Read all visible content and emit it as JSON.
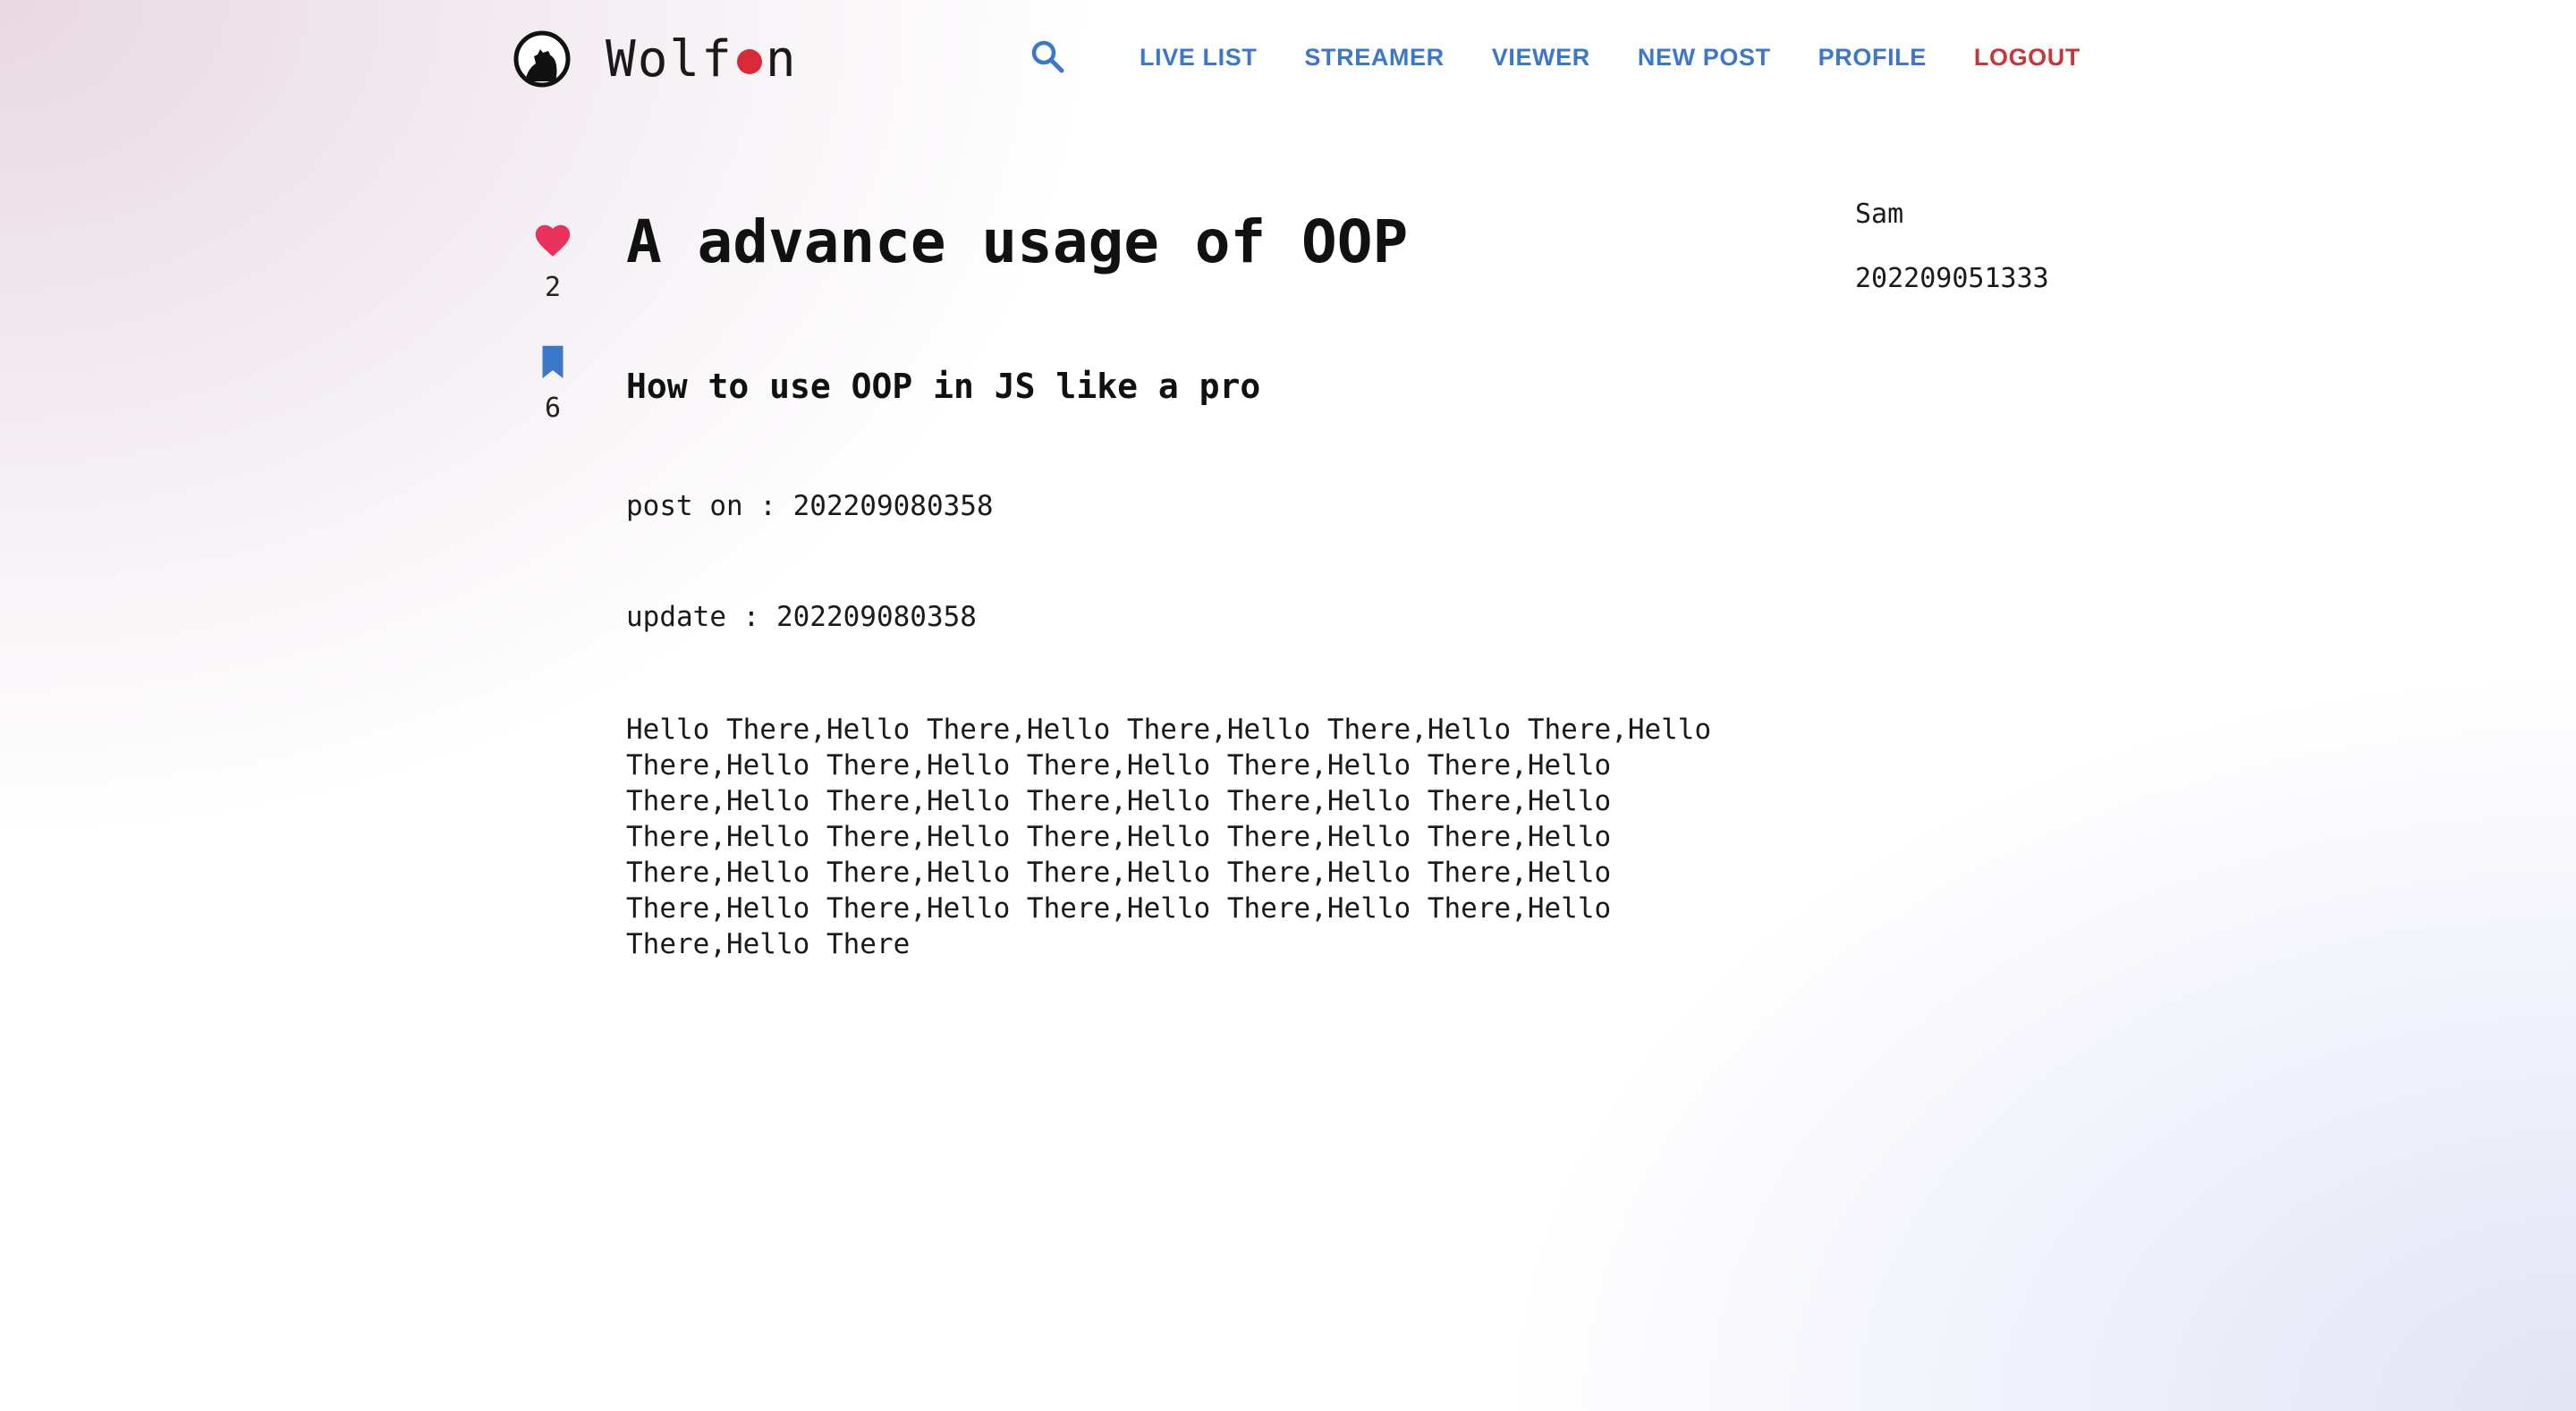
{
  "brand": {
    "name_before_dot": "Wolf",
    "name_after_dot": "n",
    "logo_icon": "wolf-howling-moon-icon",
    "dot_color": "#d92a3a"
  },
  "header": {
    "search_icon": "search-icon",
    "nav": {
      "live_list": "LIVE LIST",
      "streamer": "STREAMER",
      "viewer": "VIEWER",
      "new_post": "NEW POST",
      "profile": "PROFILE",
      "logout": "LOGOUT"
    },
    "link_color": "#3b78c9",
    "logout_color": "#c83737"
  },
  "actions": {
    "like": {
      "icon": "heart-icon",
      "count": "2",
      "color": "#e8315b"
    },
    "bookmark": {
      "icon": "bookmark-icon",
      "count": "6",
      "color": "#3b78c9"
    }
  },
  "post": {
    "title": "A advance usage of OOP",
    "subtitle": "How to use OOP in JS like a pro",
    "posted": "post on : 202209080358",
    "updated": "update : 202209080358",
    "body": "Hello There,Hello There,Hello There,Hello There,Hello There,Hello There,Hello There,Hello There,Hello There,Hello There,Hello There,Hello There,Hello There,Hello There,Hello There,Hello There,Hello There,Hello There,Hello There,Hello There,Hello There,Hello There,Hello There,Hello There,Hello There,Hello There,Hello There,Hello There,Hello There,Hello There,Hello There,Hello There"
  },
  "author": {
    "name": "Sam",
    "date": "202209051333"
  }
}
